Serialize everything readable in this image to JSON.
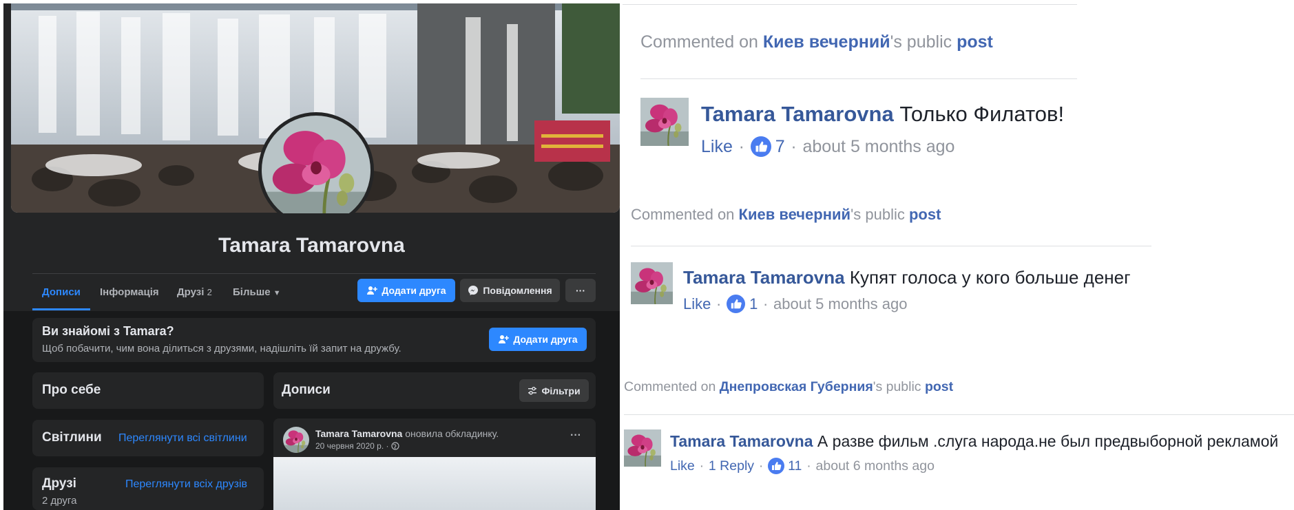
{
  "profile": {
    "name": "Tamara Tamarovna",
    "tabs": [
      {
        "label": "Дописи"
      },
      {
        "label": "Інформація"
      },
      {
        "label": "Друзі",
        "count": "2"
      },
      {
        "label": "Більше"
      }
    ],
    "add_friend_label": "Додати друга",
    "message_label": "Повідомлення",
    "more_label": "···"
  },
  "know_card": {
    "title": "Ви знайомі з Tamara?",
    "subtitle": "Щоб побачити, чим вона ділиться з друзями, надішліть їй запит на дружбу.",
    "button": "Додати друга"
  },
  "about_card": {
    "title": "Про себе"
  },
  "photos_card": {
    "title": "Світлини",
    "link": "Переглянути всі світлини"
  },
  "friends_card": {
    "title": "Друзі",
    "link": "Переглянути всіх друзів",
    "count": "2 друга"
  },
  "posts_card": {
    "title": "Дописи",
    "filters_label": "Фільтри"
  },
  "post": {
    "author": "Tamara Tamarovna",
    "action": "оновила обкладинку.",
    "date": "20 червня 2020 р. ·",
    "more_label": "···"
  },
  "comments": [
    {
      "context": {
        "prefix": "Commented on ",
        "page": "Киев вечерний",
        "middle": "'s public ",
        "post": "post"
      },
      "author": "Tamara Tamarovna",
      "text": "Только Филатов!",
      "like": "Like",
      "reply": "",
      "count": "7",
      "time": "about 5 months ago"
    },
    {
      "context": {
        "prefix": "Commented on ",
        "page": "Киев вечерний",
        "middle": "'s public ",
        "post": "post"
      },
      "author": "Tamara Tamarovna",
      "text": "Купят голоса у кого больше денег",
      "like": "Like",
      "reply": "",
      "count": "1",
      "time": "about 5 months ago"
    },
    {
      "context": {
        "prefix": "Commented on ",
        "page": "Днепровская Губерния",
        "middle": "'s public ",
        "post": "post"
      },
      "author": "Tamara Tamarovna",
      "text": "А разве фильм .слуга народа.не был предвыборной рекламой",
      "like": "Like",
      "reply": "1 Reply",
      "count": "11",
      "time": "about 6 months ago"
    }
  ],
  "meta_separator": "·",
  "colors": {
    "fb_blue": "#2d88ff",
    "dark_bg": "#18191a",
    "dark_card": "#242526",
    "link_blue": "#4267b2"
  }
}
